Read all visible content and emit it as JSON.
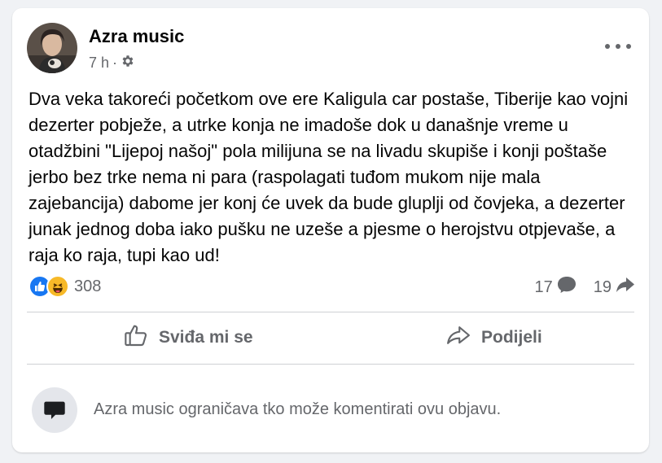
{
  "post": {
    "author": "Azra music",
    "time": "7 h",
    "separator": "·",
    "privacy_icon": "gear-icon",
    "text": "Dva veka takoreći početkom ove ere Kaligula car postaše, Tiberije kao vojni dezerter pobježe, a utrke konja ne imadoše dok u današnje vreme u otadžbini \"Lijepoj našoj\" pola milijuna se na livadu skupiše i konji poštaše jerbo bez trke nema ni para (raspolagati tuđom mukom nije mala zajebancija) dabome jer konj će uvek da bude gluplji od čovjeka, a dezerter junak jednog doba iako pušku ne uzeše a pjesme o herojstvu otpjevaše, a raja ko raja, tupi kao ud!"
  },
  "stats": {
    "reaction_icons": [
      "like-icon",
      "haha-icon"
    ],
    "reactions_count": "308",
    "comments_count": "17",
    "shares_count": "19"
  },
  "actions": {
    "like_label": "Sviđa mi se",
    "share_label": "Podijeli"
  },
  "comments": {
    "restricted_notice": "Azra music ograničava tko može komentirati ovu objavu."
  },
  "colors": {
    "like_blue": "#1877f2",
    "haha_yellow": "#f7b928",
    "secondary_text": "#65676b"
  }
}
